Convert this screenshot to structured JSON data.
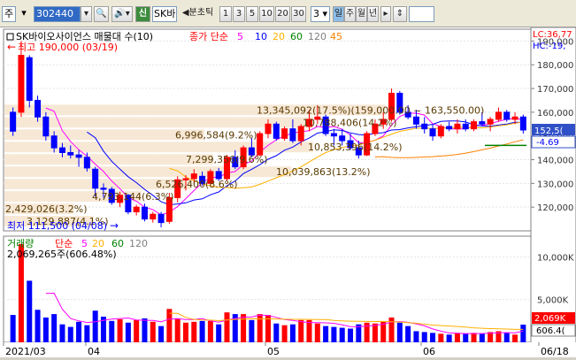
{
  "toolbar": {
    "market_label": "주",
    "code_value": "302440",
    "search_icon": "search-icon",
    "sound_icon": "speaker-icon",
    "new_badge": "신",
    "stock_name": "SK바",
    "period_label": "분초틱",
    "intervals": [
      "1",
      "3",
      "5",
      "10",
      "20",
      "30"
    ],
    "interval_selected": "3",
    "periods": [
      "일",
      "주",
      "월",
      "년"
    ],
    "period_selected": "일",
    "scroll_icon": "up-down-arrow-icon"
  },
  "price_panel": {
    "title": "SK바이오사이언스 매물대 수(10)",
    "ma_label": "종가 단순",
    "ma_periods": [
      "5",
      "10",
      "20",
      "60",
      "120",
      "45"
    ],
    "ma_colors": [
      "#ff00ff",
      "#0000ff",
      "#ffb000",
      "#008000",
      "#808080",
      "#ff8000"
    ],
    "high_label": "최고 190,000 (03/19)",
    "low_label": "최저 111,500 (04/08)",
    "lc_label": "LC:36,77",
    "hc_label": "HC:-19,",
    "current_price_badge": "152,5(",
    "current_change_badge": "-4.69",
    "y_ticks": [
      "190,000",
      "180,000",
      "170,000",
      "160,000",
      "150,000",
      "140,000",
      "130,000",
      "120,000"
    ],
    "volume_profile": [
      {
        "label": "3,129,887(4.1%)"
      },
      {
        "label": "2,429,026(3.2%)"
      },
      {
        "label": "4,793,144(6.3%)"
      },
      {
        "label": "6,526,400(8.6%)"
      },
      {
        "label": "10,039,863(13.2%)"
      },
      {
        "label": "7,299,356(9.6%)"
      },
      {
        "label": "10,853,396(14.2%)"
      },
      {
        "label": "6,996,584(9.2%)"
      },
      {
        "label": "10,788,406(14.2%)"
      },
      {
        "label": "13,345,092(17.5%)(159,000.00 ~ 163,550.00)"
      }
    ]
  },
  "volume_panel": {
    "title": "거래량",
    "ma_label": "단순",
    "ma_periods": [
      "5",
      "20",
      "60",
      "120"
    ],
    "info_label": "2,069,265주(606.48%)",
    "y_ticks": [
      "10,000K",
      "5,000K"
    ],
    "last_volume_badge": "2,069K",
    "last_ratio_badge": "606.4("
  },
  "x_axis": {
    "labels": [
      "2021/03",
      "04",
      "05",
      "06",
      "06/18"
    ]
  },
  "chart_data": {
    "type": "candlestick",
    "title": "SK바이오사이언스",
    "ylim": [
      110000,
      195000
    ],
    "candles": [
      {
        "o": 160000,
        "h": 162000,
        "l": 150000,
        "c": 152000
      },
      {
        "o": 160000,
        "h": 190000,
        "l": 158000,
        "c": 184000
      },
      {
        "o": 183000,
        "h": 184000,
        "l": 162000,
        "c": 165000
      },
      {
        "o": 165000,
        "h": 167000,
        "l": 156000,
        "c": 158000
      },
      {
        "o": 158000,
        "h": 160000,
        "l": 148000,
        "c": 150000
      },
      {
        "o": 150000,
        "h": 152000,
        "l": 143000,
        "c": 145000
      },
      {
        "o": 145000,
        "h": 147000,
        "l": 141000,
        "c": 143000
      },
      {
        "o": 143000,
        "h": 146000,
        "l": 140500,
        "c": 142000
      },
      {
        "o": 142000,
        "h": 144000,
        "l": 137000,
        "c": 141000
      },
      {
        "o": 141000,
        "h": 143000,
        "l": 135000,
        "c": 136500
      },
      {
        "o": 136000,
        "h": 137000,
        "l": 124500,
        "c": 128000
      },
      {
        "o": 128000,
        "h": 130000,
        "l": 124000,
        "c": 127500
      },
      {
        "o": 127500,
        "h": 128500,
        "l": 121000,
        "c": 122000
      },
      {
        "o": 122000,
        "h": 126500,
        "l": 120000,
        "c": 125000
      },
      {
        "o": 125000,
        "h": 125500,
        "l": 117000,
        "c": 118000
      },
      {
        "o": 118000,
        "h": 121000,
        "l": 116500,
        "c": 120000
      },
      {
        "o": 120000,
        "h": 121500,
        "l": 114000,
        "c": 115000
      },
      {
        "o": 115000,
        "h": 118000,
        "l": 113500,
        "c": 117000
      },
      {
        "o": 117000,
        "h": 118000,
        "l": 111500,
        "c": 113500
      },
      {
        "o": 114000,
        "h": 126000,
        "l": 113000,
        "c": 124000
      },
      {
        "o": 124000,
        "h": 133000,
        "l": 122000,
        "c": 131500
      },
      {
        "o": 131500,
        "h": 133500,
        "l": 127000,
        "c": 132000
      },
      {
        "o": 132000,
        "h": 136000,
        "l": 130000,
        "c": 134000
      },
      {
        "o": 133000,
        "h": 135000,
        "l": 129000,
        "c": 130000
      },
      {
        "o": 130000,
        "h": 136000,
        "l": 129500,
        "c": 135000
      },
      {
        "o": 135000,
        "h": 136500,
        "l": 131000,
        "c": 132000
      },
      {
        "o": 132000,
        "h": 142000,
        "l": 131000,
        "c": 141000
      },
      {
        "o": 141000,
        "h": 144000,
        "l": 136000,
        "c": 137000
      },
      {
        "o": 137000,
        "h": 146000,
        "l": 136000,
        "c": 145000
      },
      {
        "o": 145000,
        "h": 149000,
        "l": 141000,
        "c": 142000
      },
      {
        "o": 142000,
        "h": 152000,
        "l": 141500,
        "c": 151000
      },
      {
        "o": 151000,
        "h": 157000,
        "l": 149000,
        "c": 155000
      },
      {
        "o": 155000,
        "h": 156000,
        "l": 148000,
        "c": 149000
      },
      {
        "o": 149000,
        "h": 154000,
        "l": 148000,
        "c": 153000
      },
      {
        "o": 153000,
        "h": 157000,
        "l": 147000,
        "c": 148000
      },
      {
        "o": 148000,
        "h": 155000,
        "l": 146000,
        "c": 154000
      },
      {
        "o": 154000,
        "h": 161000,
        "l": 152000,
        "c": 157000
      },
      {
        "o": 157000,
        "h": 163000,
        "l": 155000,
        "c": 158000
      },
      {
        "o": 158000,
        "h": 159000,
        "l": 150000,
        "c": 151000
      },
      {
        "o": 151000,
        "h": 153000,
        "l": 146000,
        "c": 150000
      },
      {
        "o": 150000,
        "h": 153000,
        "l": 146000,
        "c": 148000
      },
      {
        "o": 148000,
        "h": 151000,
        "l": 144000,
        "c": 145000
      },
      {
        "o": 145000,
        "h": 148000,
        "l": 140500,
        "c": 142000
      },
      {
        "o": 142000,
        "h": 152000,
        "l": 141500,
        "c": 151000
      },
      {
        "o": 151000,
        "h": 157000,
        "l": 150000,
        "c": 155000
      },
      {
        "o": 155000,
        "h": 160000,
        "l": 153000,
        "c": 157000
      },
      {
        "o": 157000,
        "h": 170000,
        "l": 156000,
        "c": 168000
      },
      {
        "o": 168000,
        "h": 169000,
        "l": 159000,
        "c": 160000
      },
      {
        "o": 160000,
        "h": 163000,
        "l": 157000,
        "c": 158000
      },
      {
        "o": 158000,
        "h": 161000,
        "l": 153000,
        "c": 155000
      },
      {
        "o": 155000,
        "h": 158000,
        "l": 151000,
        "c": 153000
      },
      {
        "o": 153000,
        "h": 155000,
        "l": 148000,
        "c": 150000
      },
      {
        "o": 150000,
        "h": 155000,
        "l": 149000,
        "c": 154000
      },
      {
        "o": 154000,
        "h": 156000,
        "l": 152000,
        "c": 153000
      },
      {
        "o": 153000,
        "h": 157000,
        "l": 151000,
        "c": 155000
      },
      {
        "o": 155000,
        "h": 157000,
        "l": 152000,
        "c": 153000
      },
      {
        "o": 153000,
        "h": 157000,
        "l": 152000,
        "c": 156000
      },
      {
        "o": 156000,
        "h": 160000,
        "l": 154000,
        "c": 155000
      },
      {
        "o": 155000,
        "h": 158000,
        "l": 152000,
        "c": 157000
      },
      {
        "o": 157000,
        "h": 162000,
        "l": 156000,
        "c": 160000
      },
      {
        "o": 160000,
        "h": 161000,
        "l": 156000,
        "c": 157000
      },
      {
        "o": 157000,
        "h": 160000,
        "l": 155000,
        "c": 158000
      },
      {
        "o": 158000,
        "h": 159000,
        "l": 151000,
        "c": 152500
      }
    ],
    "volume": [
      3200,
      11500,
      7200,
      3800,
      2900,
      3300,
      2100,
      1800,
      2400,
      2000,
      3700,
      3000,
      2500,
      2700,
      2300,
      2600,
      2800,
      2400,
      1900,
      3900,
      2800,
      2300,
      2400,
      2500,
      2500,
      2100,
      3500,
      3300,
      3300,
      2600,
      3300,
      3200,
      2200,
      2000,
      2100,
      2600,
      2600,
      2200,
      1900,
      1800,
      1700,
      1600,
      2100,
      2300,
      2200,
      2400,
      2900,
      2300,
      1900,
      1300,
      1200,
      1100,
      1000,
      900,
      1100,
      1000,
      1100,
      1000,
      1200,
      1300,
      1100,
      900,
      2069
    ]
  }
}
